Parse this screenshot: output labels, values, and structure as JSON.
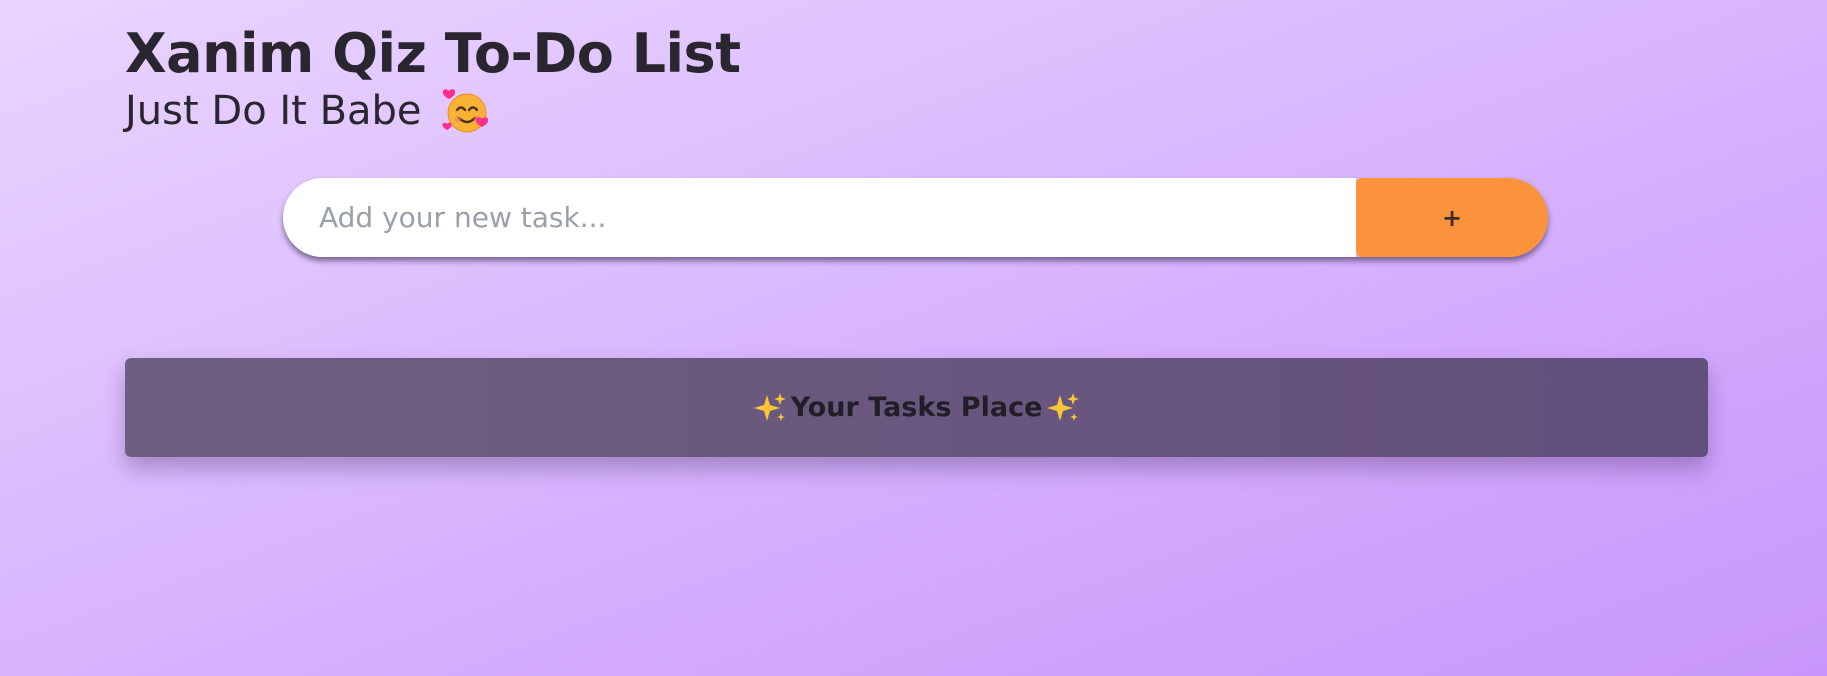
{
  "header": {
    "title": "Xanim Qiz To-Do List",
    "subtitle": "Just Do It Babe",
    "emoji_icon": "smiling-face-with-hearts-icon"
  },
  "add_task": {
    "placeholder": "Add your new task...",
    "value": "",
    "button_label": "+",
    "button_color": "#fb923c"
  },
  "tasks_panel": {
    "title": "Your Tasks Place",
    "leading_icon": "sparkles-icon",
    "trailing_icon": "sparkles-icon",
    "background_color": "#6a5a7e"
  },
  "colors": {
    "background_start": "#e9d5ff",
    "background_end": "#c896fb",
    "text": "#2a2630"
  }
}
